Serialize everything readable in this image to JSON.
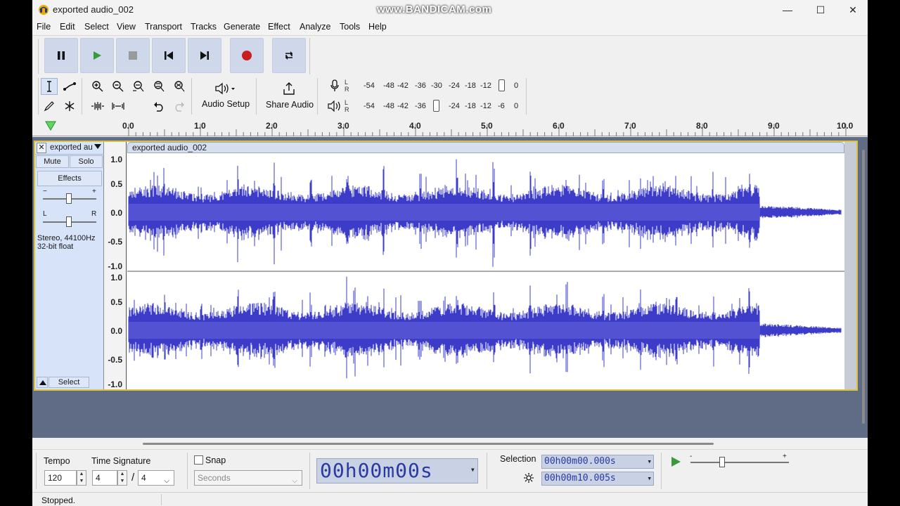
{
  "window": {
    "title": "exported audio_002",
    "watermark": "www.BANDICAM.com",
    "minimize": "—",
    "maximize": "☐",
    "close": "✕"
  },
  "menu": [
    "File",
    "Edit",
    "Select",
    "View",
    "Transport",
    "Tracks",
    "Generate",
    "Effect",
    "Analyze",
    "Tools",
    "Help"
  ],
  "transport": {
    "buttons": [
      "pause",
      "play",
      "stop",
      "skip-to-start",
      "skip-to-end",
      "record",
      "loop"
    ],
    "colors": {
      "play": "#3a9a3a",
      "record": "#c81e1e",
      "stop": "#9a9a9a"
    }
  },
  "toolbar": {
    "audio_setup_label": "Audio Setup",
    "share_audio_label": "Share Audio"
  },
  "meters": {
    "record_ticks": [
      "-54",
      "-48",
      "-42",
      "-36",
      "-30",
      "-24",
      "-18",
      "-12",
      "0"
    ],
    "playback_ticks": [
      "-54",
      "-48",
      "-42",
      "-36",
      "-24",
      "-18",
      "-12",
      "-6",
      "0"
    ],
    "l": "L",
    "r": "R"
  },
  "ruler": {
    "labels": [
      "0.0",
      "1.0",
      "2.0",
      "3.0",
      "4.0",
      "5.0",
      "6.0",
      "7.0",
      "8.0",
      "9.0",
      "10.0"
    ]
  },
  "track": {
    "name": "exported au",
    "clip_name": "exported audio_002",
    "mute_label": "Mute",
    "solo_label": "Solo",
    "effects_label": "Effects",
    "gain_minus": "−",
    "gain_plus": "+",
    "pan_l": "L",
    "pan_r": "R",
    "info_line1": "Stereo, 44100Hz",
    "info_line2": "32-bit float",
    "select_label": "Select",
    "scale_labels": [
      "1.0",
      "0.5",
      "0.0",
      "-0.5",
      "-1.0"
    ],
    "wave_color": "#3c3cc8"
  },
  "bottom": {
    "tempo_label": "Tempo",
    "tempo_value": "120",
    "time_signature_label": "Time Signature",
    "ts_numerator": "4",
    "ts_slash": "/",
    "ts_denominator": "4",
    "snap_label": "Snap",
    "snap_unit": "Seconds",
    "big_time": "00h00m00s",
    "selection_label": "Selection",
    "selection_start": "00h00m00.000s",
    "selection_end": "00h00m10.005s"
  },
  "status": "Stopped."
}
